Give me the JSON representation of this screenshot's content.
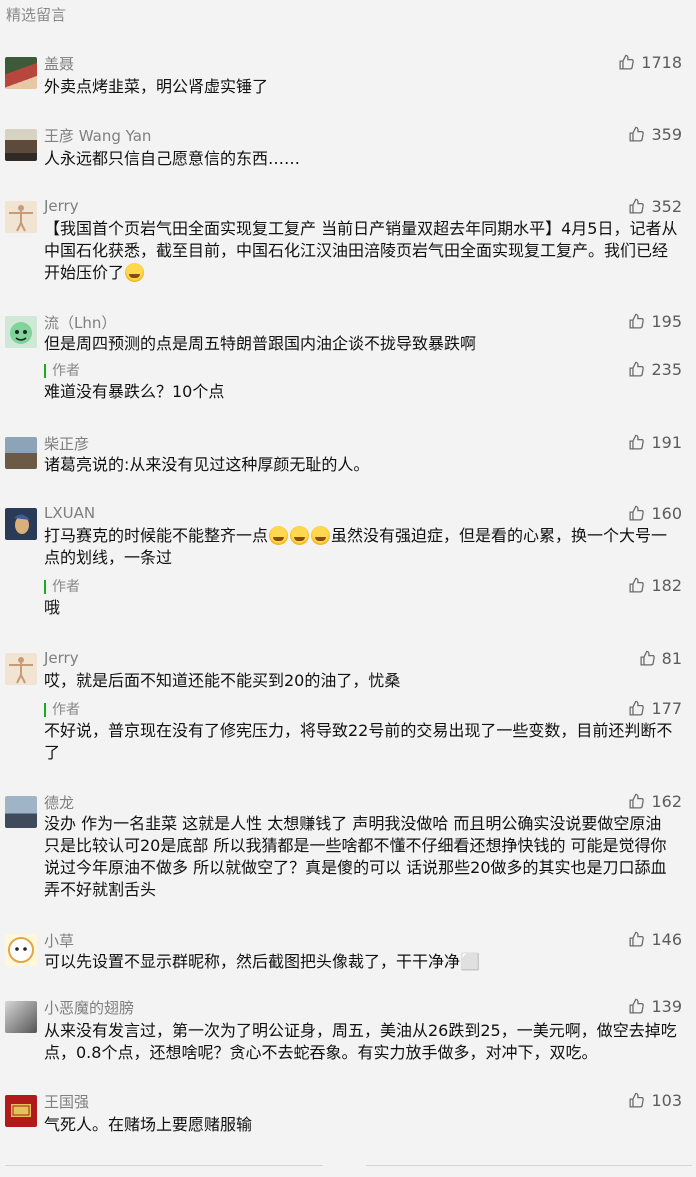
{
  "section_title": "精选留言",
  "comments": [
    {
      "nickname": "盖聂",
      "likes": "1718",
      "content": "外卖点烤韭菜，明公肾虚实锤了",
      "avatar_colors": [
        "#b7463c",
        "#3d5a3a"
      ]
    },
    {
      "nickname": "王彦 Wang Yan",
      "likes": "359",
      "content": "人永远都只信自己愿意信的东西……",
      "avatar_colors": [
        "#5d4a3b",
        "#d8d2c3"
      ]
    },
    {
      "nickname": "Jerry",
      "likes": "352",
      "content_parts": [
        "【我国首个页岩气田全面实现复工复产 当前日产销量双超去年同期水平】4月5日，记者从中国石化获悉，截至目前，中国石化江汉油田涪陵页岩气田全面实现复工复产。我们已经开始压价了"
      ],
      "avatar_colors": [
        "#f1e4d3",
        "#c9b79c"
      ]
    },
    {
      "nickname": "流（Lhn）",
      "likes": "195",
      "content": "但是周四预测的点是周五特朗普跟国内油企谈不拢导致暴跌啊",
      "avatar_colors": [
        "#cfe9d6",
        "#5cb87d"
      ],
      "reply": {
        "author": "作者",
        "likes": "235",
        "content": "难道没有暴跌么？10个点"
      }
    },
    {
      "nickname": "柴正彦",
      "likes": "191",
      "content": "诸葛亮说的:从来没有见过这种厚颜无耻的人。",
      "avatar_colors": [
        "#8da4b8",
        "#6b5a45"
      ]
    },
    {
      "nickname": "LXUAN",
      "likes": "160",
      "content_a": "打马赛克的时候能不能整齐一点",
      "content_b": "虽然没有强迫症，但是看的心累，换一个大号一点的划线，一条过",
      "avatar_colors": [
        "#2b3b57",
        "#d9b07a"
      ],
      "reply": {
        "author": "作者",
        "likes": "182",
        "content": "哦"
      }
    },
    {
      "nickname": "Jerry",
      "likes": "81",
      "content": "哎，就是后面不知道还能不能买到20的油了，忧桑",
      "avatar_colors": [
        "#f1e4d3",
        "#c9b79c"
      ],
      "reply": {
        "author": "作者",
        "likes": "177",
        "content": "不好说，普京现在没有了修宪压力，将导致22号前的交易出现了一些变数，目前还判断不了"
      }
    },
    {
      "nickname": "德龙",
      "likes": "162",
      "content": "没办 作为一名韭菜 这就是人性 太想赚钱了 声明我没做哈 而且明公确实没说要做空原油 只是比较认可20是底部 所以我猜都是一些啥都不懂不仔细看还想挣快钱的 可能是觉得你说过今年原油不做多 所以就做空了？真是傻的可以 话说那些20做多的其实也是刀口舔血 弄不好就割舌头",
      "avatar_colors": [
        "#9fb4c6",
        "#3f4b5a"
      ]
    },
    {
      "nickname": "小草",
      "likes": "146",
      "content": "可以先设置不显示群昵称，然后截图把头像裁了，干干净净⬜",
      "avatar_colors": [
        "#fff7da",
        "#e0a64a"
      ]
    },
    {
      "nickname": "小恶魔的翅膀",
      "likes": "139",
      "content": "从来没有发言过，第一次为了明公证身，周五，美油从26跌到25，一美元啊，做空去掉吃点，0.8个点，还想啥呢？贪心不去蛇吞象。有实力放手做多，对冲下，双吃。",
      "avatar_colors": [
        "#b9b9b9",
        "#555"
      ]
    },
    {
      "nickname": "王国强",
      "likes": "103",
      "content": "气死人。在赌场上要愿赌服输",
      "avatar_colors": [
        "#b11a1a",
        "#e3c25a"
      ]
    }
  ]
}
